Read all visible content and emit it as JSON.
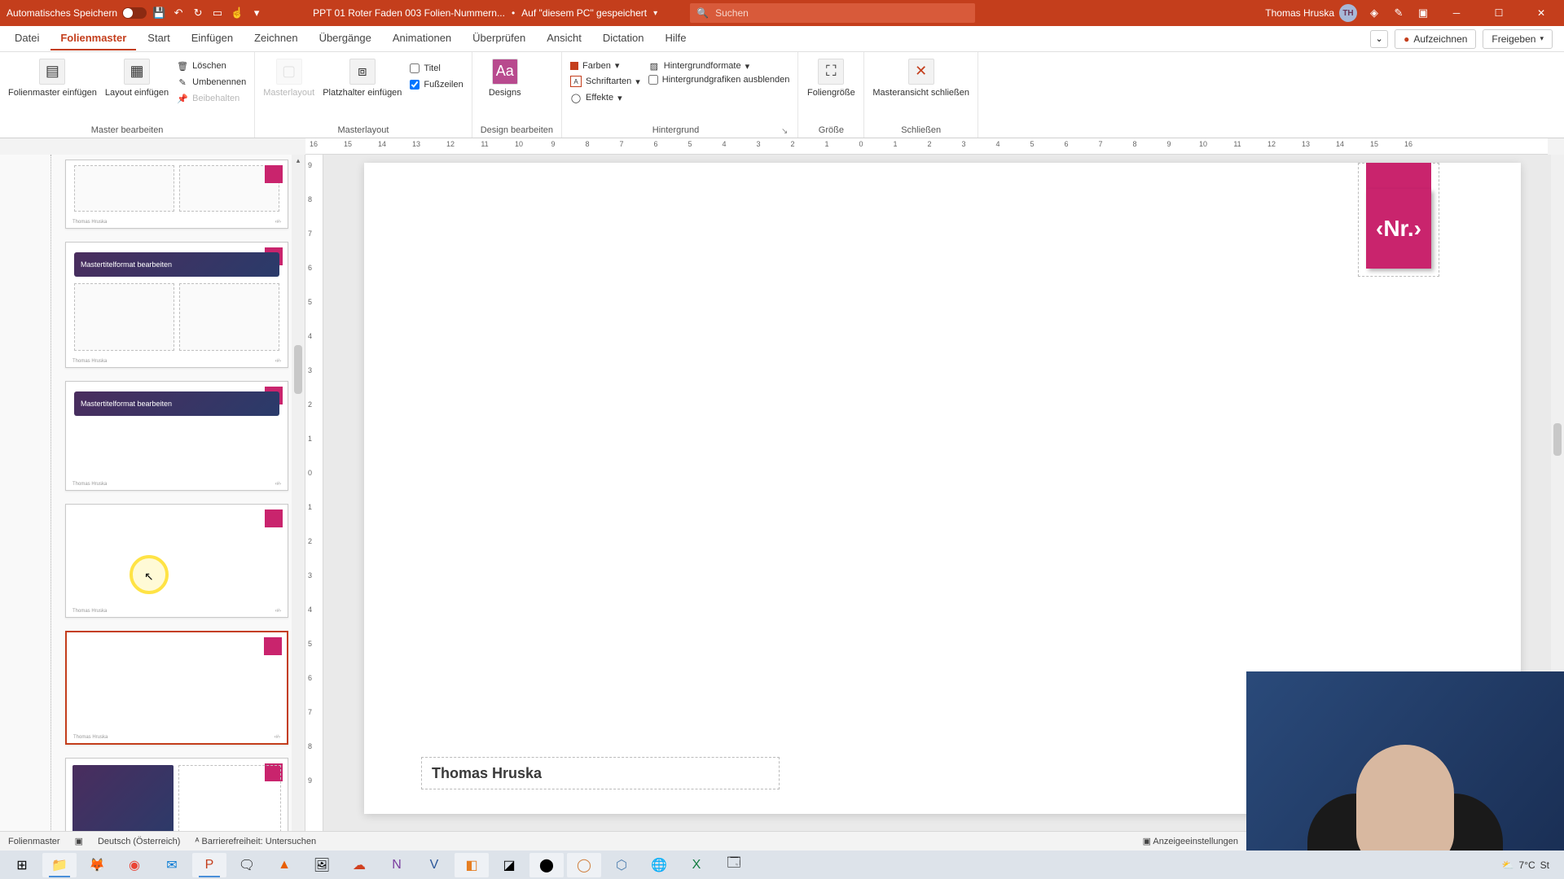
{
  "titlebar": {
    "autosave": "Automatisches Speichern",
    "doc_name": "PPT 01 Roter Faden 003 Folien-Nummern...",
    "save_status": "Auf \"diesem PC\" gespeichert",
    "search_placeholder": "Suchen",
    "user_name": "Thomas Hruska",
    "user_initials": "TH"
  },
  "tabs": {
    "t0": "Datei",
    "t1": "Folienmaster",
    "t2": "Start",
    "t3": "Einfügen",
    "t4": "Zeichnen",
    "t5": "Übergänge",
    "t6": "Animationen",
    "t7": "Überprüfen",
    "t8": "Ansicht",
    "t9": "Dictation",
    "t10": "Hilfe",
    "record": "Aufzeichnen",
    "share": "Freigeben"
  },
  "ribbon": {
    "g1": {
      "insert_master": "Folienmaster einfügen",
      "insert_layout": "Layout einfügen",
      "delete": "Löschen",
      "rename": "Umbenennen",
      "keep": "Beibehalten",
      "label": "Master bearbeiten"
    },
    "g2": {
      "master_layout": "Masterlayout",
      "placeholder": "Platzhalter einfügen",
      "title_cb": "Titel",
      "footer_cb": "Fußzeilen",
      "label": "Masterlayout"
    },
    "g3": {
      "designs": "Designs",
      "label": "Design bearbeiten"
    },
    "g4": {
      "colors": "Farben",
      "fonts": "Schriftarten",
      "effects": "Effekte",
      "bg_formats": "Hintergrundformate",
      "hide_bg": "Hintergrundgrafiken ausblenden",
      "label": "Hintergrund"
    },
    "g5": {
      "slide_size": "Foliengröße",
      "label": "Größe"
    },
    "g6": {
      "close": "Masteransicht schließen",
      "label": "Schließen"
    }
  },
  "ruler_h": [
    "16",
    "15",
    "14",
    "13",
    "12",
    "11",
    "10",
    "9",
    "8",
    "7",
    "6",
    "5",
    "4",
    "3",
    "2",
    "1",
    "0",
    "1",
    "2",
    "3",
    "4",
    "5",
    "6",
    "7",
    "8",
    "9",
    "10",
    "11",
    "12",
    "13",
    "14",
    "15",
    "16"
  ],
  "ruler_v": [
    "9",
    "8",
    "7",
    "6",
    "5",
    "4",
    "3",
    "2",
    "1",
    "0",
    "1",
    "2",
    "3",
    "4",
    "5",
    "6",
    "7",
    "8",
    "9"
  ],
  "thumbs": {
    "title_text": "Mastertitelformat bearbeiten",
    "footer_left": "Thomas Hruska"
  },
  "slide": {
    "nr": "‹Nr.›",
    "footer": "Thomas Hruska"
  },
  "status": {
    "mode": "Folienmaster",
    "lang": "Deutsch (Österreich)",
    "access": "Barrierefreiheit: Untersuchen",
    "display": "Anzeigeeinstellungen"
  },
  "taskbar": {
    "weather_temp": "7°C",
    "weather_desc": "St"
  }
}
